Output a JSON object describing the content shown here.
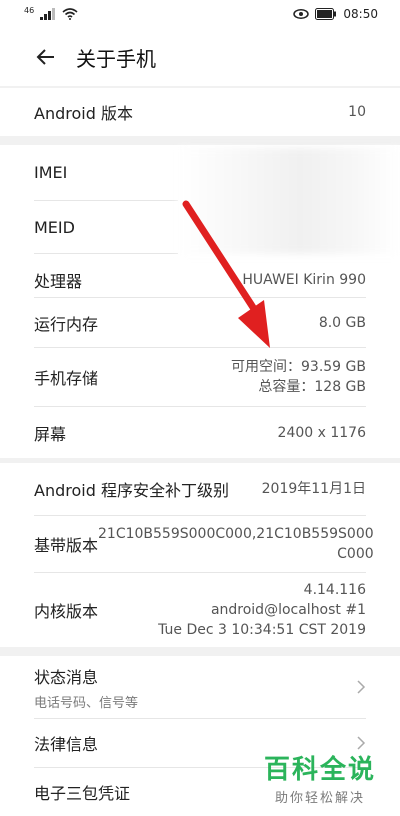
{
  "status_bar": {
    "signal": "46",
    "time": "08:50"
  },
  "app_bar": {
    "title": "关于手机"
  },
  "rows": {
    "android_version": {
      "label": "Android 版本",
      "value": "10"
    },
    "imei": {
      "label": "IMEI"
    },
    "meid": {
      "label": "MEID"
    },
    "processor": {
      "label": "处理器",
      "value": "HUAWEI Kirin 990"
    },
    "ram": {
      "label": "运行内存",
      "value": "8.0 GB"
    },
    "storage": {
      "label": "手机存储",
      "value_line1": "可用空间：93.59  GB",
      "value_line2": "总容量：128  GB"
    },
    "screen": {
      "label": "屏幕",
      "value": "2400 x 1176"
    },
    "security_patch": {
      "label": "Android 程序安全补丁级别",
      "value": "2019年11月1日"
    },
    "baseband": {
      "label": "基带版本",
      "value_line1": "21C10B559S000C000,21C10B559S000",
      "value_line2": "C000"
    },
    "kernel": {
      "label": "内核版本",
      "value_line1": "4.14.116",
      "value_line2": "android@localhost #1",
      "value_line3": "Tue Dec 3 10:34:51 CST 2019"
    },
    "status_info": {
      "label": "状态消息",
      "sub": "电话号码、信号等"
    },
    "legal": {
      "label": "法律信息"
    },
    "warranty": {
      "label": "电子三包凭证"
    }
  },
  "watermark": {
    "main": "百科全说",
    "sub": "助你轻松解决"
  },
  "colors": {
    "accent": "#2bb45b",
    "arrow": "#e02020",
    "background": "#f1f1f1"
  }
}
